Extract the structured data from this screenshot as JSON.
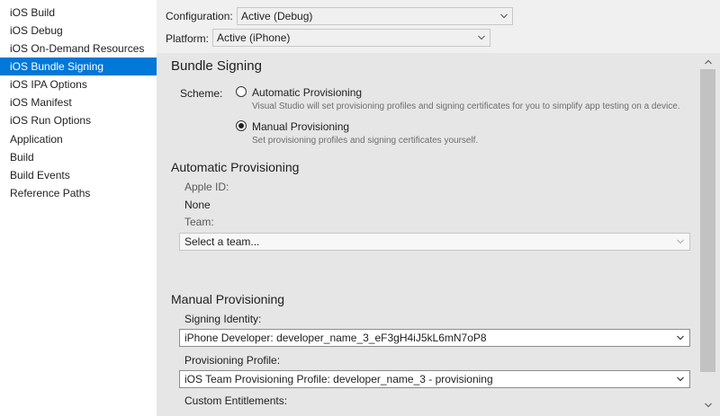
{
  "sidebar": {
    "items": [
      {
        "label": "iOS Build",
        "selected": false
      },
      {
        "label": "iOS Debug",
        "selected": false
      },
      {
        "label": "iOS On-Demand Resources",
        "selected": false
      },
      {
        "label": "iOS Bundle Signing",
        "selected": true
      },
      {
        "label": "iOS IPA Options",
        "selected": false
      },
      {
        "label": "iOS Manifest",
        "selected": false
      },
      {
        "label": "iOS Run Options",
        "selected": false
      },
      {
        "label": "Application",
        "selected": false
      },
      {
        "label": "Build",
        "selected": false
      },
      {
        "label": "Build Events",
        "selected": false
      },
      {
        "label": "Reference Paths",
        "selected": false
      }
    ],
    "accent_color": "#0078d7"
  },
  "config": {
    "configuration_label": "Configuration:",
    "configuration_value": "Active (Debug)",
    "platform_label": "Platform:",
    "platform_value": "Active (iPhone)"
  },
  "bundle_signing": {
    "title": "Bundle Signing",
    "scheme_label": "Scheme:",
    "automatic": {
      "label": "Automatic Provisioning",
      "description": "Visual Studio will set provisioning profiles and signing certificates for you to simplify app testing on a device.",
      "checked": false
    },
    "manual": {
      "label": "Manual Provisioning",
      "description": "Set provisioning profiles and signing certificates yourself.",
      "checked": true
    }
  },
  "automatic_provisioning": {
    "title": "Automatic Provisioning",
    "apple_id_label": "Apple ID:",
    "apple_id_value": "None",
    "team_label": "Team:",
    "team_placeholder": "Select a team..."
  },
  "manual_provisioning": {
    "title": "Manual Provisioning",
    "signing_identity_label": "Signing Identity:",
    "signing_identity_value": "iPhone Developer: developer_name_3_eF3gH4iJ5kL6mN7oP8",
    "provisioning_profile_label": "Provisioning Profile:",
    "provisioning_profile_value": "iOS Team Provisioning Profile: developer_name_3 - provisioning",
    "custom_entitlements_label": "Custom Entitlements:"
  }
}
